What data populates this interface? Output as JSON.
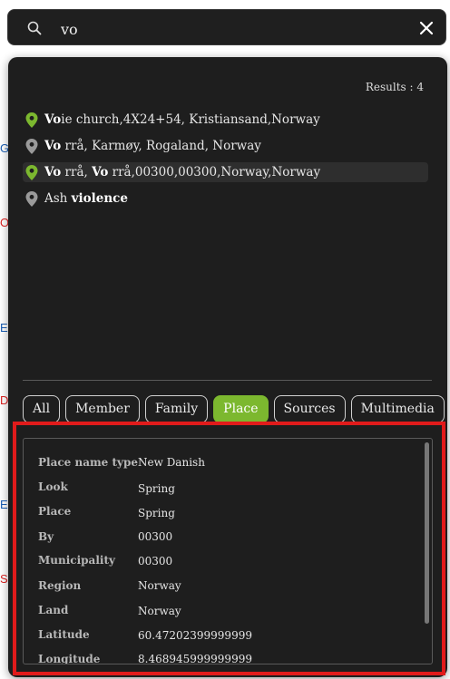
{
  "background_fragments": [
    "G",
    "OT",
    "E",
    "D",
    "E",
    "SD"
  ],
  "search": {
    "value": "vo",
    "placeholder": ""
  },
  "results": {
    "count_label": "Results : 4",
    "items": [
      {
        "bold": "Vo",
        "rest": "ie church,4X24+54, Kristiansand,Norway",
        "pin": "green"
      },
      {
        "bold": "Vo",
        "rest": " rrå, Karmøy, Rogaland, Norway",
        "pin": "gray"
      },
      {
        "bold": "Vo",
        "rest": " rrå, ",
        "bold2": "Vo",
        "rest2": " rrå,00300,00300,Norway,Norway",
        "pin": "green"
      },
      {
        "prefix": "Ash ",
        "bold": "violence",
        "rest": "",
        "pin": "gray"
      }
    ]
  },
  "tabs": [
    "All",
    "Member",
    "Family",
    "Place",
    "Sources",
    "Multimedia"
  ],
  "active_tab": "Place",
  "details": [
    {
      "label": "Place name type",
      "value": "New Danish"
    },
    {
      "label": "Look",
      "value": "Spring"
    },
    {
      "label": "Place",
      "value": "Spring"
    },
    {
      "label": "By",
      "value": "00300"
    },
    {
      "label": "Municipality",
      "value": "00300"
    },
    {
      "label": "Region",
      "value": "Norway"
    },
    {
      "label": "Land",
      "value": "Norway"
    },
    {
      "label": "Latitude",
      "value": "60.47202399999999"
    },
    {
      "label": "Longitude",
      "value": "8.468945999999999"
    }
  ],
  "colors": {
    "accent": "#7cb82f",
    "highlight": "#e11b1b",
    "panel": "#1e1e1e"
  }
}
